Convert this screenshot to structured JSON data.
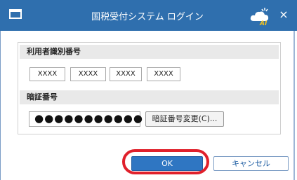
{
  "window": {
    "title": "国税受付システム ログイン",
    "ai_icon": "cloud-ai-icon",
    "close_glyph": "×",
    "ai_badge": "AI"
  },
  "user_id": {
    "label": "利用者識別番号",
    "segments": [
      "XXXX",
      "XXXX",
      "XXXX",
      "XXXX"
    ]
  },
  "password": {
    "label": "暗証番号",
    "masked_value": "●●●●●●●●●●●",
    "change_button": "暗証番号変更(C)..."
  },
  "buttons": {
    "ok": "OK",
    "cancel": "キャンセル"
  },
  "colors": {
    "titlebar": "#2f6fae",
    "ok_button": "#2f76c2",
    "highlight": "#e0202b"
  }
}
